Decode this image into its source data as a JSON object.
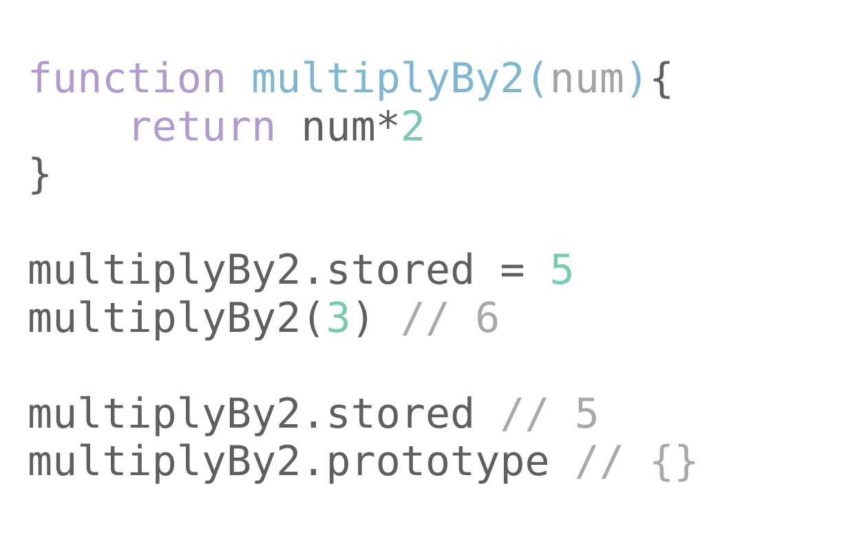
{
  "code": {
    "line1": {
      "keyword": "function",
      "space": " ",
      "fn_name_open": "multiplyBy2(",
      "param": "num",
      "paren_close": ")",
      "brace_open": "{"
    },
    "line2": {
      "indent": "    ",
      "keyword": "return",
      "expr": " num*",
      "number": "2"
    },
    "line3": {
      "brace_close": "}"
    },
    "line5": {
      "statement": "multiplyBy2.stored = ",
      "number": "5"
    },
    "line6": {
      "call_open": "multiplyBy2(",
      "number": "3",
      "call_close": ") ",
      "comment": "// 6"
    },
    "line8": {
      "statement": "multiplyBy2.stored ",
      "comment": "// 5"
    },
    "line9": {
      "statement": "multiplyBy2.prototype ",
      "comment": "// {}"
    }
  },
  "colors": {
    "keyword": "#b09ad0",
    "function_name": "#7fb6d2",
    "parameter": "#a3a3a3",
    "number": "#79cbb0",
    "comment": "#a8a8a8",
    "plain": "#5f5f5f",
    "background": "#ffffff"
  }
}
